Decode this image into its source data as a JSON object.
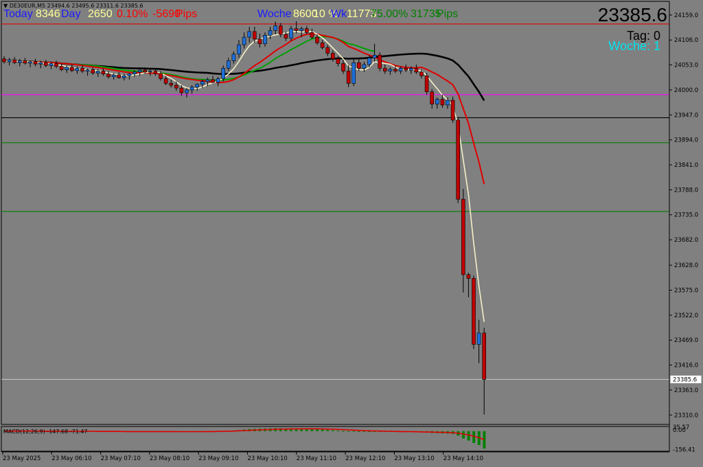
{
  "symbol_info": "DE30EUR,M5  23494.6 23495.6 23311.6 23385.6",
  "header": {
    "today_label": "Today",
    "today_value": "8346",
    "day_label": "Day",
    "day_value": "2650",
    "day_pct": "0.10%",
    "day_points": "-5690",
    "day_unit": "Pips",
    "week_label": "Woche",
    "week_value": "8600",
    "week_pct": "10 %",
    "wk_label": "Wk",
    "wk_value": "11773",
    "wk_pct": "75.00%",
    "wk_points": "31735",
    "wk_unit": "Pips"
  },
  "big_price": "23385.6",
  "tag_label": "Tag:  0",
  "woche_label": "Woche:  1",
  "colors": {
    "background": "#808080",
    "bull": "#1e6fd9",
    "bear": "#c00000",
    "ma_fast": "#f5f0c8",
    "ma_mid": "#00a000",
    "ma_red": "#e00000",
    "ma_slow": "#000000",
    "level_magenta": "#ff00ff",
    "level_red": "#e00000",
    "level_green": "#008000",
    "cyan": "#00e5ee",
    "header_blue": "#1a1aff",
    "header_yellow": "#ffff99",
    "header_red": "#ff0000",
    "header_green": "#008000"
  },
  "chart_data": {
    "type": "candlestick",
    "y_axis_ticks": [
      "24159.0",
      "24106.0",
      "24053.0",
      "24000.0",
      "23947.0",
      "23894.0",
      "23841.0",
      "23788.0",
      "23735.0",
      "23682.0",
      "23628.0",
      "23575.0",
      "23522.0",
      "23469.0",
      "23416.0",
      "23363.0",
      "23310.0"
    ],
    "ylim": [
      23290,
      24188
    ],
    "current_price_label": "23385.6",
    "horizontal_levels": [
      {
        "price": 24140,
        "color": "red"
      },
      {
        "price": 23990,
        "color": "magenta"
      },
      {
        "price": 23941,
        "color": "black"
      },
      {
        "price": 23888,
        "color": "green"
      },
      {
        "price": 23742,
        "color": "green"
      },
      {
        "price": 23385.6,
        "color": "lightgray"
      }
    ],
    "x_axis_labels": [
      "23 May 2025",
      "23 May 06:10",
      "23 May 07:10",
      "23 May 08:10",
      "23 May 09:10",
      "23 May 10:10",
      "23 May 11:10",
      "23 May 12:10",
      "23 May 13:10",
      "23 May 14:10"
    ],
    "candles": [
      {
        "o": 24066,
        "h": 24072,
        "l": 24056,
        "c": 24060
      },
      {
        "o": 24060,
        "h": 24068,
        "l": 24052,
        "c": 24064
      },
      {
        "o": 24064,
        "h": 24070,
        "l": 24055,
        "c": 24058
      },
      {
        "o": 24058,
        "h": 24066,
        "l": 24050,
        "c": 24062
      },
      {
        "o": 24062,
        "h": 24068,
        "l": 24054,
        "c": 24057
      },
      {
        "o": 24057,
        "h": 24063,
        "l": 24048,
        "c": 24060
      },
      {
        "o": 24060,
        "h": 24066,
        "l": 24050,
        "c": 24055
      },
      {
        "o": 24055,
        "h": 24062,
        "l": 24046,
        "c": 24058
      },
      {
        "o": 24058,
        "h": 24064,
        "l": 24048,
        "c": 24052
      },
      {
        "o": 24052,
        "h": 24060,
        "l": 24044,
        "c": 24056
      },
      {
        "o": 24056,
        "h": 24062,
        "l": 24046,
        "c": 24050
      },
      {
        "o": 24050,
        "h": 24056,
        "l": 24040,
        "c": 24043
      },
      {
        "o": 24043,
        "h": 24052,
        "l": 24036,
        "c": 24048
      },
      {
        "o": 24048,
        "h": 24054,
        "l": 24038,
        "c": 24041
      },
      {
        "o": 24041,
        "h": 24050,
        "l": 24034,
        "c": 24046
      },
      {
        "o": 24046,
        "h": 24052,
        "l": 24036,
        "c": 24040
      },
      {
        "o": 24040,
        "h": 24046,
        "l": 24030,
        "c": 24043
      },
      {
        "o": 24043,
        "h": 24048,
        "l": 24032,
        "c": 24036
      },
      {
        "o": 24036,
        "h": 24044,
        "l": 24028,
        "c": 24040
      },
      {
        "o": 24040,
        "h": 24046,
        "l": 24030,
        "c": 24034
      },
      {
        "o": 24034,
        "h": 24040,
        "l": 24024,
        "c": 24028
      },
      {
        "o": 24028,
        "h": 24036,
        "l": 24022,
        "c": 24032
      },
      {
        "o": 24032,
        "h": 24038,
        "l": 24024,
        "c": 24026
      },
      {
        "o": 24026,
        "h": 24034,
        "l": 24020,
        "c": 24030
      },
      {
        "o": 24030,
        "h": 24036,
        "l": 24022,
        "c": 24034
      },
      {
        "o": 24034,
        "h": 24042,
        "l": 24028,
        "c": 24038
      },
      {
        "o": 24038,
        "h": 24045,
        "l": 24030,
        "c": 24042
      },
      {
        "o": 24042,
        "h": 24048,
        "l": 24034,
        "c": 24038
      },
      {
        "o": 24038,
        "h": 24044,
        "l": 24030,
        "c": 24040
      },
      {
        "o": 24040,
        "h": 24046,
        "l": 24030,
        "c": 24035
      },
      {
        "o": 24035,
        "h": 24040,
        "l": 24020,
        "c": 24024
      },
      {
        "o": 24024,
        "h": 24030,
        "l": 24010,
        "c": 24014
      },
      {
        "o": 24014,
        "h": 24022,
        "l": 24005,
        "c": 24010
      },
      {
        "o": 24010,
        "h": 24018,
        "l": 23998,
        "c": 24004
      },
      {
        "o": 24004,
        "h": 24010,
        "l": 23988,
        "c": 23994
      },
      {
        "o": 23994,
        "h": 24004,
        "l": 23984,
        "c": 24000
      },
      {
        "o": 24000,
        "h": 24010,
        "l": 23992,
        "c": 24006
      },
      {
        "o": 24006,
        "h": 24014,
        "l": 23998,
        "c": 24012
      },
      {
        "o": 24012,
        "h": 24022,
        "l": 24004,
        "c": 24018
      },
      {
        "o": 24018,
        "h": 24026,
        "l": 24008,
        "c": 24022
      },
      {
        "o": 24022,
        "h": 24030,
        "l": 24014,
        "c": 24016
      },
      {
        "o": 24016,
        "h": 24028,
        "l": 24008,
        "c": 24024
      },
      {
        "o": 24024,
        "h": 24052,
        "l": 24018,
        "c": 24046
      },
      {
        "o": 24046,
        "h": 24068,
        "l": 24040,
        "c": 24062
      },
      {
        "o": 24062,
        "h": 24082,
        "l": 24056,
        "c": 24076
      },
      {
        "o": 24076,
        "h": 24106,
        "l": 24068,
        "c": 24096
      },
      {
        "o": 24096,
        "h": 24122,
        "l": 24088,
        "c": 24112
      },
      {
        "o": 24112,
        "h": 24134,
        "l": 24100,
        "c": 24124
      },
      {
        "o": 24124,
        "h": 24134,
        "l": 24100,
        "c": 24108
      },
      {
        "o": 24108,
        "h": 24120,
        "l": 24090,
        "c": 24098
      },
      {
        "o": 24098,
        "h": 24122,
        "l": 24092,
        "c": 24116
      },
      {
        "o": 24116,
        "h": 24134,
        "l": 24108,
        "c": 24126
      },
      {
        "o": 24126,
        "h": 24145,
        "l": 24118,
        "c": 24136
      },
      {
        "o": 24136,
        "h": 24142,
        "l": 24112,
        "c": 24118
      },
      {
        "o": 24118,
        "h": 24124,
        "l": 24104,
        "c": 24110
      },
      {
        "o": 24110,
        "h": 24136,
        "l": 24104,
        "c": 24130
      },
      {
        "o": 24130,
        "h": 24146,
        "l": 24120,
        "c": 24126
      },
      {
        "o": 24126,
        "h": 24134,
        "l": 24112,
        "c": 24130
      },
      {
        "o": 24130,
        "h": 24136,
        "l": 24118,
        "c": 24122
      },
      {
        "o": 24122,
        "h": 24130,
        "l": 24108,
        "c": 24112
      },
      {
        "o": 24112,
        "h": 24118,
        "l": 24096,
        "c": 24100
      },
      {
        "o": 24100,
        "h": 24106,
        "l": 24086,
        "c": 24090
      },
      {
        "o": 24090,
        "h": 24096,
        "l": 24072,
        "c": 24078
      },
      {
        "o": 24078,
        "h": 24084,
        "l": 24060,
        "c": 24066
      },
      {
        "o": 24066,
        "h": 24072,
        "l": 24050,
        "c": 24056
      },
      {
        "o": 24056,
        "h": 24064,
        "l": 24034,
        "c": 24040
      },
      {
        "o": 24040,
        "h": 24052,
        "l": 24006,
        "c": 24014
      },
      {
        "o": 24014,
        "h": 24066,
        "l": 24008,
        "c": 24058
      },
      {
        "o": 24058,
        "h": 24066,
        "l": 24040,
        "c": 24046
      },
      {
        "o": 24046,
        "h": 24060,
        "l": 24038,
        "c": 24054
      },
      {
        "o": 24054,
        "h": 24074,
        "l": 24048,
        "c": 24068
      },
      {
        "o": 24068,
        "h": 24098,
        "l": 24060,
        "c": 24074
      },
      {
        "o": 24074,
        "h": 24080,
        "l": 24040,
        "c": 24046
      },
      {
        "o": 24046,
        "h": 24054,
        "l": 24034,
        "c": 24040
      },
      {
        "o": 24040,
        "h": 24048,
        "l": 24032,
        "c": 24044
      },
      {
        "o": 24044,
        "h": 24052,
        "l": 24036,
        "c": 24040
      },
      {
        "o": 24040,
        "h": 24050,
        "l": 24034,
        "c": 24046
      },
      {
        "o": 24046,
        "h": 24054,
        "l": 24038,
        "c": 24042
      },
      {
        "o": 24042,
        "h": 24050,
        "l": 24034,
        "c": 24046
      },
      {
        "o": 24046,
        "h": 24054,
        "l": 24034,
        "c": 24038
      },
      {
        "o": 24038,
        "h": 24044,
        "l": 24024,
        "c": 24030
      },
      {
        "o": 24030,
        "h": 24036,
        "l": 23990,
        "c": 23996
      },
      {
        "o": 23996,
        "h": 24002,
        "l": 23960,
        "c": 23970
      },
      {
        "o": 23970,
        "h": 23984,
        "l": 23960,
        "c": 23980
      },
      {
        "o": 23980,
        "h": 23990,
        "l": 23962,
        "c": 23968
      },
      {
        "o": 23968,
        "h": 23984,
        "l": 23960,
        "c": 23978
      },
      {
        "o": 23978,
        "h": 23986,
        "l": 23930,
        "c": 23936
      },
      {
        "o": 23936,
        "h": 23942,
        "l": 23760,
        "c": 23768
      },
      {
        "o": 23768,
        "h": 23790,
        "l": 23570,
        "c": 23608
      },
      {
        "o": 23608,
        "h": 23612,
        "l": 23560,
        "c": 23600
      },
      {
        "o": 23600,
        "h": 23606,
        "l": 23450,
        "c": 23460
      },
      {
        "o": 23460,
        "h": 23512,
        "l": 23420,
        "c": 23484
      },
      {
        "o": 23484,
        "h": 23495,
        "l": 23311,
        "c": 23385.6
      }
    ],
    "macd": {
      "label": "MACD(12,26,9) -147.68 -71.47",
      "y_ticks": [
        "0.00",
        "35.57",
        "-156.41"
      ],
      "ylim": [
        -170,
        40
      ],
      "histogram": [
        2,
        2,
        2,
        2,
        1,
        1,
        1,
        1,
        0,
        0,
        0,
        -1,
        -1,
        -1,
        -1,
        -2,
        -2,
        -2,
        -2,
        -3,
        -3,
        -3,
        -3,
        -3,
        -3,
        -3,
        -2,
        -2,
        -2,
        -2,
        -3,
        -4,
        -5,
        -6,
        -7,
        -7,
        -6,
        -5,
        -4,
        -3,
        -2,
        -1,
        1,
        3,
        6,
        10,
        14,
        18,
        20,
        21,
        22,
        23,
        25,
        25,
        24,
        23,
        23,
        22,
        21,
        19,
        17,
        14,
        11,
        8,
        5,
        2,
        -1,
        -2,
        -3,
        -3,
        -2,
        -2,
        -3,
        -5,
        -6,
        -7,
        -7,
        -7,
        -7,
        -8,
        -9,
        -12,
        -15,
        -17,
        -19,
        -20,
        -23,
        -38,
        -62,
        -80,
        -100,
        -118,
        -147.68
      ],
      "signal": [
        1,
        1,
        1,
        1,
        1,
        1,
        1,
        1,
        0,
        0,
        0,
        0,
        -1,
        -1,
        -1,
        -1,
        -1,
        -1,
        -2,
        -2,
        -2,
        -2,
        -2,
        -3,
        -3,
        -3,
        -3,
        -3,
        -3,
        -3,
        -3,
        -3,
        -3,
        -4,
        -4,
        -4,
        -4,
        -4,
        -4,
        -3,
        -3,
        -2,
        -1,
        0,
        1,
        3,
        5,
        7,
        9,
        11,
        13,
        14,
        16,
        17,
        18,
        19,
        19,
        20,
        20,
        20,
        20,
        19,
        18,
        17,
        15,
        13,
        11,
        9,
        7,
        5,
        3,
        2,
        1,
        0,
        -1,
        -2,
        -3,
        -3,
        -4,
        -5,
        -6,
        -7,
        -8,
        -9,
        -10,
        -11,
        -13,
        -17,
        -24,
        -32,
        -42,
        -55,
        -71.47
      ]
    }
  }
}
